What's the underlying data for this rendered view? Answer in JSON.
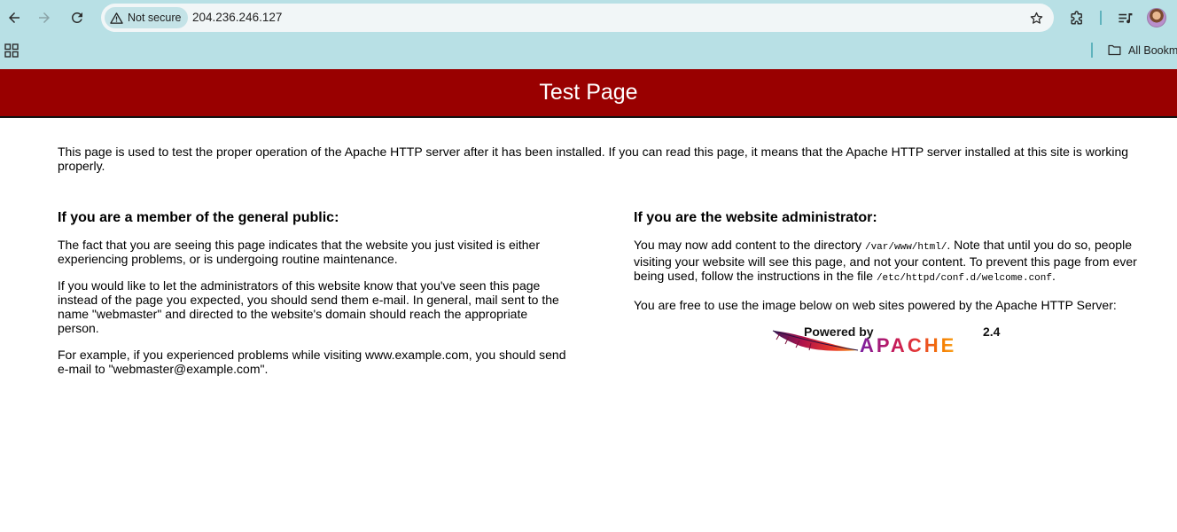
{
  "browser": {
    "security_label": "Not secure",
    "url": "204.236.246.127",
    "bookmarks_label": "All Bookmarks"
  },
  "page": {
    "title": "Test Page",
    "intro": "This page is used to test the proper operation of the Apache HTTP server after it has been installed. If you can read this page, it means that the Apache HTTP server installed at this site is working properly.",
    "public": {
      "heading": "If you are a member of the general public:",
      "p1": "The fact that you are seeing this page indicates that the website you just visited is either experiencing problems, or is undergoing routine maintenance.",
      "p2": "If you would like to let the administrators of this website know that you've seen this page instead of the page you expected, you should send them e-mail. In general, mail sent to the name \"webmaster\" and directed to the website's domain should reach the appropriate person.",
      "p3": "For example, if you experienced problems while visiting www.example.com, you should send e-mail to \"webmaster@example.com\"."
    },
    "admin": {
      "heading": "If you are the website administrator:",
      "p1_a": "You may now add content to the directory ",
      "p1_code1": "/var/www/html/",
      "p1_b": ". Note that until you do so, people visiting your website will see this page, and not your content. To prevent this page from ever being used, follow the instructions in the file ",
      "p1_code2": "/etc/httpd/conf.d/welcome.conf",
      "p1_c": ".",
      "p2": "You are free to use the image below on web sites powered by the Apache HTTP Server:"
    },
    "logo": {
      "powered_by": "Powered by",
      "version": "2.4",
      "name": "APACHE"
    }
  },
  "colors": {
    "banner": "#990000",
    "chrome": "#b8e0e5"
  },
  "icons": [
    "back-arrow-icon",
    "forward-arrow-icon",
    "reload-icon",
    "warning-icon",
    "star-icon",
    "extensions-icon",
    "media-control-icon",
    "apps-grid-icon",
    "folder-icon",
    "apache-feather-icon"
  ]
}
